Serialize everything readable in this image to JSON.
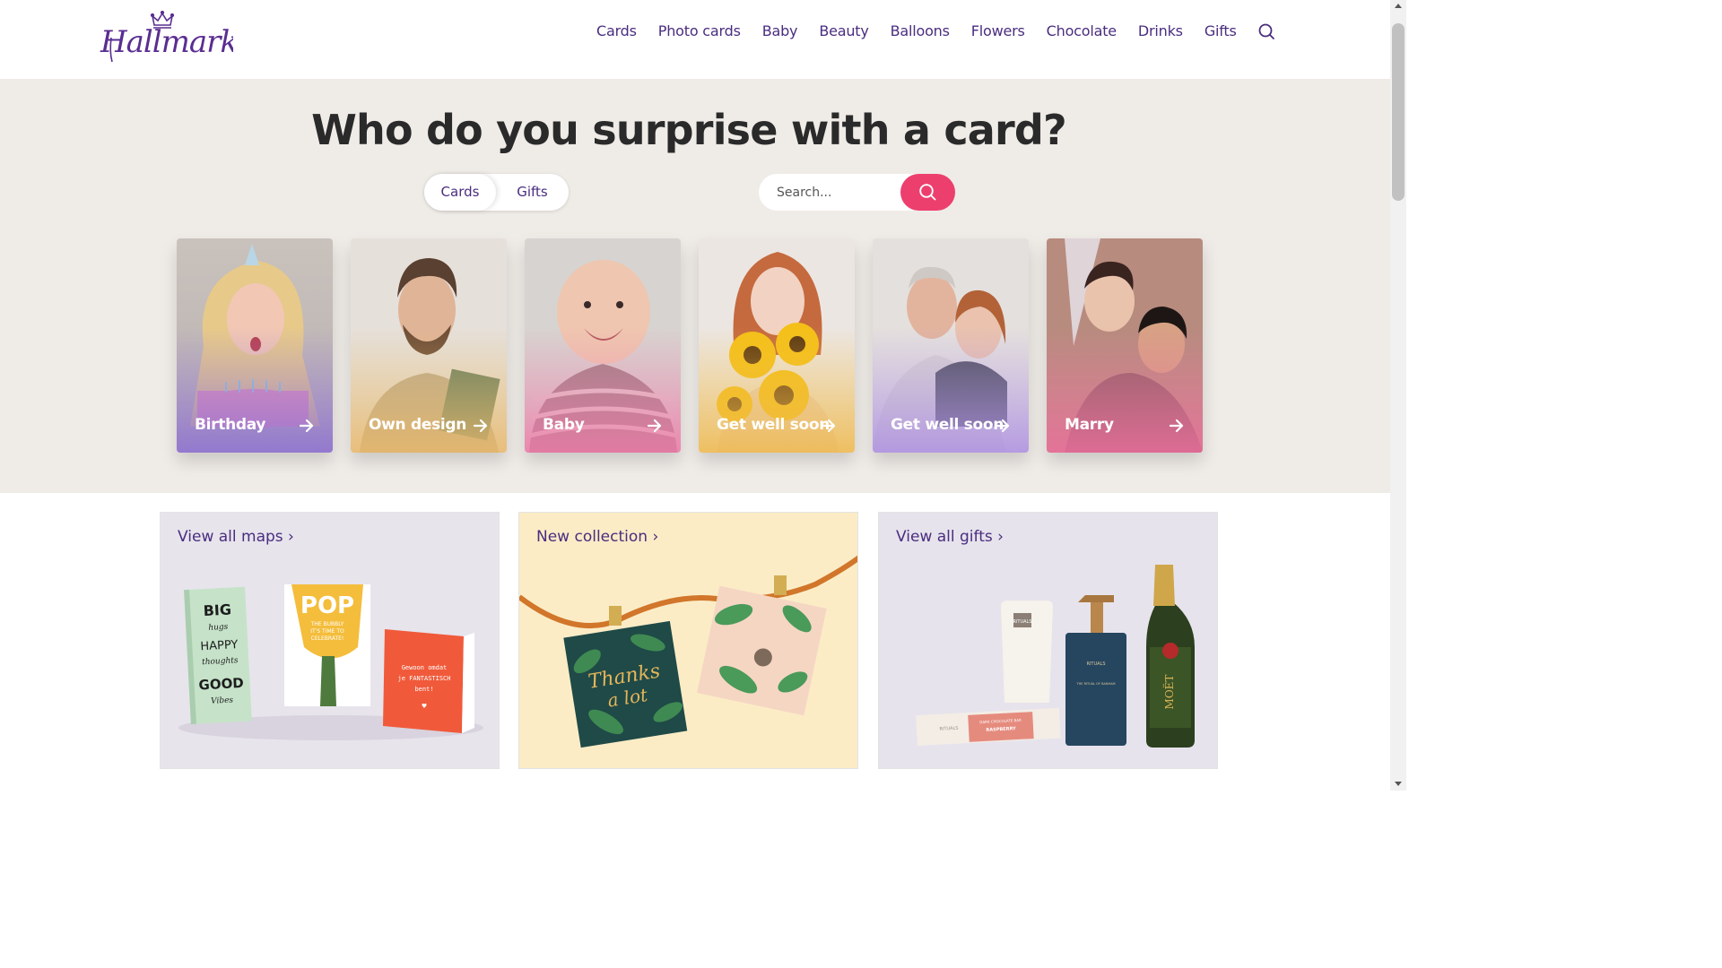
{
  "brand": {
    "name": "Hallmark",
    "color": "#5a2d91",
    "accent": "#ec3f6e"
  },
  "nav": {
    "items": [
      "Cards",
      "Photo cards",
      "Baby",
      "Beauty",
      "Balloons",
      "Flowers",
      "Chocolate",
      "Drinks",
      "Gifts"
    ],
    "search_icon": "search-icon"
  },
  "hero": {
    "title": "Who do you surprise with a card?",
    "toggle": {
      "cards_label": "Cards",
      "gifts_label": "Gifts",
      "selected": "Cards"
    },
    "search": {
      "placeholder": "Search...",
      "value": "",
      "button_icon": "search-icon"
    }
  },
  "categories": [
    {
      "label": "Birthday",
      "icon": "arrow-right-icon"
    },
    {
      "label": "Own design",
      "icon": "arrow-right-icon"
    },
    {
      "label": "Baby",
      "icon": "arrow-right-icon"
    },
    {
      "label": "Get well soon",
      "icon": "arrow-right-icon"
    },
    {
      "label": "Get well soon",
      "icon": "arrow-right-icon"
    },
    {
      "label": "Marry",
      "icon": "arrow-right-icon"
    }
  ],
  "promos": [
    {
      "label": "View all maps ›"
    },
    {
      "label": "New collection ›"
    },
    {
      "label": "View all gifts ›"
    }
  ],
  "promo_artwork": {
    "card_big": [
      "BIG",
      "hugs",
      "HAPPY",
      "thoughts",
      "GOOD",
      "Vibes"
    ],
    "card_pop": [
      "POP",
      "THE BUBBLY",
      "IT'S TIME TO",
      "CELEBRATE!"
    ],
    "card_red": [
      "Gewoon omdat",
      "je FANTASTISCH",
      "bent!",
      "♥"
    ],
    "card_thanks": [
      "Thanks",
      "a lot"
    ],
    "gift_choc": [
      "RITUALS",
      "DARK CHOCOLATE BAR",
      "RASPBERRY"
    ],
    "gift_soap": [
      "RITUALS",
      "THE RITUAL OF BANHAM"
    ],
    "gift_bottle": "MOËT"
  }
}
